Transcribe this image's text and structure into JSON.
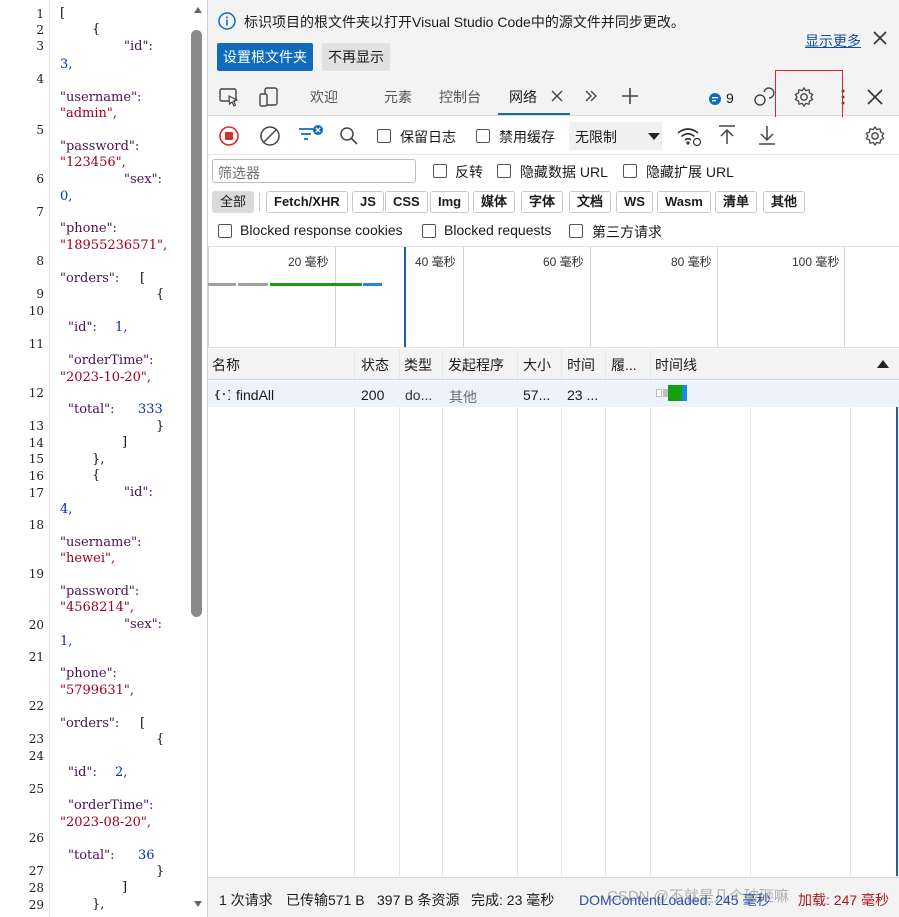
{
  "code_lines": [
    {
      "n": "1",
      "t": "["
    },
    {
      "n": "2",
      "t": "{"
    },
    {
      "n": "3",
      "k": "\"id\":",
      "v": "3,"
    },
    {
      "n": "4",
      "k": "\"username\":",
      "v": "\"admin\","
    },
    {
      "n": "5",
      "k": "\"password\":",
      "v": "\"123456\",",
      "k2": "\"sex\":",
      "v2": "0,"
    },
    {
      "n": "7",
      "k": "\"phone\":",
      "v": "\"18955236571\","
    },
    {
      "n": "8",
      "k": "\"orders\": [",
      "v": ""
    },
    {
      "n": "9",
      "t": "{"
    },
    {
      "n": "11",
      "k": "\"id\": 1,"
    },
    {
      "n": "12",
      "k": "\"orderTime\":",
      "v": "\"2023-10-20\","
    },
    {
      "n": "13",
      "k": "\"total\": 333"
    },
    {
      "n": "16",
      "t": "{"
    },
    {
      "n": "17",
      "k": "\"id\":",
      "v": "4,"
    },
    {
      "n": "18",
      "k": "\"username\":",
      "v": "\"hewei\","
    },
    {
      "n": "19",
      "k": "\"password\":",
      "v": "\"4568214\",",
      "k2": "\"sex\":",
      "v2": "1,"
    },
    {
      "n": "21",
      "k": "\"phone\":",
      "v": "\"5799631\","
    },
    {
      "n": "22",
      "k": "\"orders\": [",
      "v": ""
    },
    {
      "n": "23",
      "t": "{"
    },
    {
      "n": "25",
      "k": "\"id\": 2,"
    },
    {
      "n": "26",
      "k": "\"orderTime\":",
      "v": "\"2023-08-20\","
    },
    {
      "n": "27",
      "k": "\"total\": 36"
    }
  ],
  "code": {
    "l1": "[",
    "l2": "{",
    "l3k": "\"id\":",
    "l3v": "3,",
    "l4k": "\"username\":",
    "l4v": "\"admin\",",
    "l5k": "\"password\":",
    "l5v": "\"123456\",",
    "l6k": "\"sex\":",
    "l6v": "0,",
    "l7k": "\"phone\":",
    "l7v": "\"18955236571\",",
    "l8k": "\"orders\":",
    "l8b": "[",
    "l9": "{",
    "l11k": "\"id\":",
    "l11v": "1,",
    "l12k": "\"orderTime\":",
    "l12v": "\"2023-10-20\",",
    "l13k": "\"total\":",
    "l13v": "333",
    "close_brace": "}",
    "close_bracket": "]",
    "close_brace_comma": "},",
    "l17k": "\"id\":",
    "l17v": "4,",
    "l18k": "\"username\":",
    "l18v": "\"hewei\",",
    "l19k": "\"password\":",
    "l19v": "\"4568214\",",
    "l20k": "\"sex\":",
    "l20v": "1,",
    "l21k": "\"phone\":",
    "l21v": "\"5799631\",",
    "l22k": "\"orders\":",
    "l22b": "[",
    "l25k": "\"id\":",
    "l25v": "2,",
    "l26k": "\"orderTime\":",
    "l26v": "\"2023-08-20\",",
    "l27k": "\"total\":",
    "l27v": "36"
  },
  "line_numbers": [
    "1",
    "2",
    "3",
    "4",
    "5",
    "6",
    "7",
    "8",
    "9",
    "10",
    "11",
    "12",
    "13",
    "14",
    "15",
    "16",
    "17",
    "18",
    "19",
    "20",
    "21",
    "22",
    "23",
    "24",
    "25",
    "26",
    "27",
    "28",
    "29"
  ],
  "infobar": {
    "message": "标识项目的根文件夹以打开Visual Studio Code中的源文件并同步更改。",
    "show_more": "显示更多",
    "set_root": "设置根文件夹",
    "dont_show": "不再显示"
  },
  "tabs": {
    "welcome": "欢迎",
    "elements": "元素",
    "console": "控制台",
    "network": "网络",
    "issues_count": "9"
  },
  "toolbar": {
    "preserve_log": "保留日志",
    "disable_cache": "禁用缓存",
    "throttling": "无限制"
  },
  "filter": {
    "placeholder": "筛选器",
    "invert": "反转",
    "hide_data_urls": "隐藏数据 URL",
    "hide_ext_urls": "隐藏扩展 URL",
    "types": [
      "全部",
      "Fetch/XHR",
      "JS",
      "CSS",
      "Img",
      "媒体",
      "字体",
      "文档",
      "WS",
      "Wasm",
      "清单",
      "其他"
    ],
    "blocked_cookies": "Blocked response cookies",
    "blocked_requests": "Blocked requests",
    "third_party": "第三方请求"
  },
  "overview": {
    "ticks": [
      "20  毫秒",
      "40  毫秒",
      "60  毫秒",
      "80  毫秒",
      "100  毫秒"
    ]
  },
  "table": {
    "headers": [
      "名称",
      "状态",
      "类型",
      "发起程序",
      "大小",
      "时间",
      "履...",
      "时间线"
    ],
    "rows": [
      {
        "name": "findAll",
        "status": "200",
        "type": "do...",
        "initiator": "其他",
        "size": "57...",
        "time": "23 ..."
      }
    ]
  },
  "statusbar": {
    "requests": "1 次请求",
    "transferred": "已传输571 B",
    "resources": "397 B 条资源",
    "finish": "完成:  23  毫秒",
    "dom_loaded": "DOMContentLoaded: 245 毫秒",
    "load": "加载: 247  毫秒"
  },
  "watermark": "CSDN @不就是几个破砸嘛",
  "colors": {
    "accent_blue": "#0f6cbd",
    "highlight_red": "#e0242b",
    "record_red": "#d32f2f",
    "waterfall_green": "#13a10e"
  }
}
